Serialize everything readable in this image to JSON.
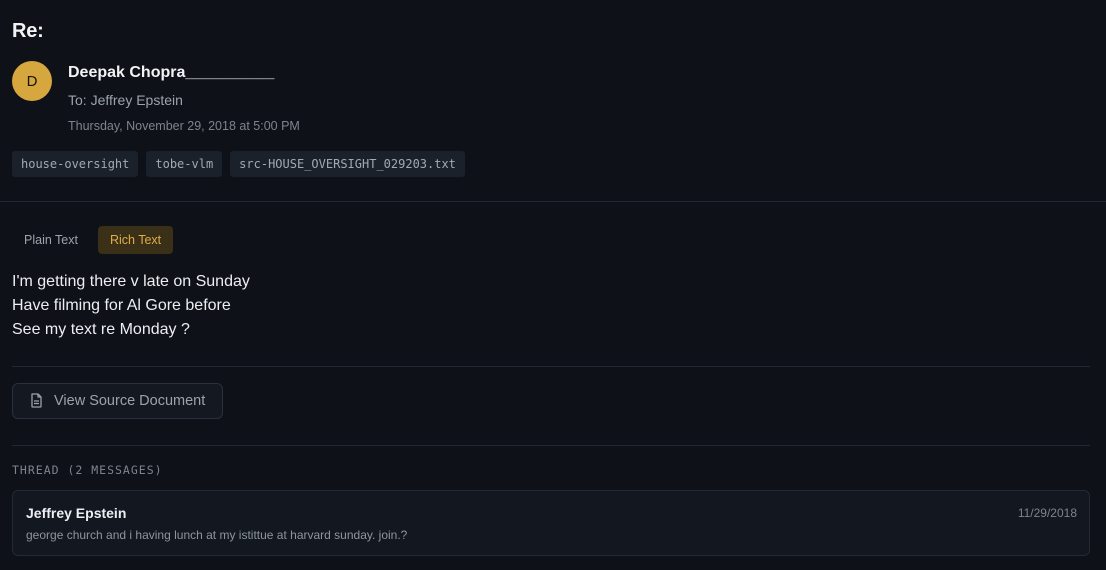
{
  "email": {
    "subject": "Re:",
    "sender_initial": "D",
    "sender_name": "Deepak Chopra__________",
    "to_line": "To: Jeffrey Epstein",
    "date": "Thursday, November 29, 2018 at 5:00 PM",
    "tags": [
      "house-oversight",
      "tobe-vlm",
      "src-HOUSE_OVERSIGHT_029203.txt"
    ]
  },
  "view_tabs": [
    {
      "label": "Plain Text",
      "active": false
    },
    {
      "label": "Rich Text",
      "active": true
    }
  ],
  "body_lines": [
    "I'm getting there v late on Sunday",
    "Have filming for Al Gore before",
    "See my text re Monday ?"
  ],
  "source_button": {
    "label": "View Source Document",
    "icon": "document-icon"
  },
  "thread": {
    "header": "THREAD (2 MESSAGES)",
    "messages": [
      {
        "sender": "Jeffrey Epstein",
        "date": "11/29/2018",
        "preview": "george church and i having lunch at my istittue at harvard sunday. join.?"
      }
    ]
  },
  "colors": {
    "background": "#0e1117",
    "avatar": "#d7a73f",
    "accent": "#e0ad48"
  }
}
